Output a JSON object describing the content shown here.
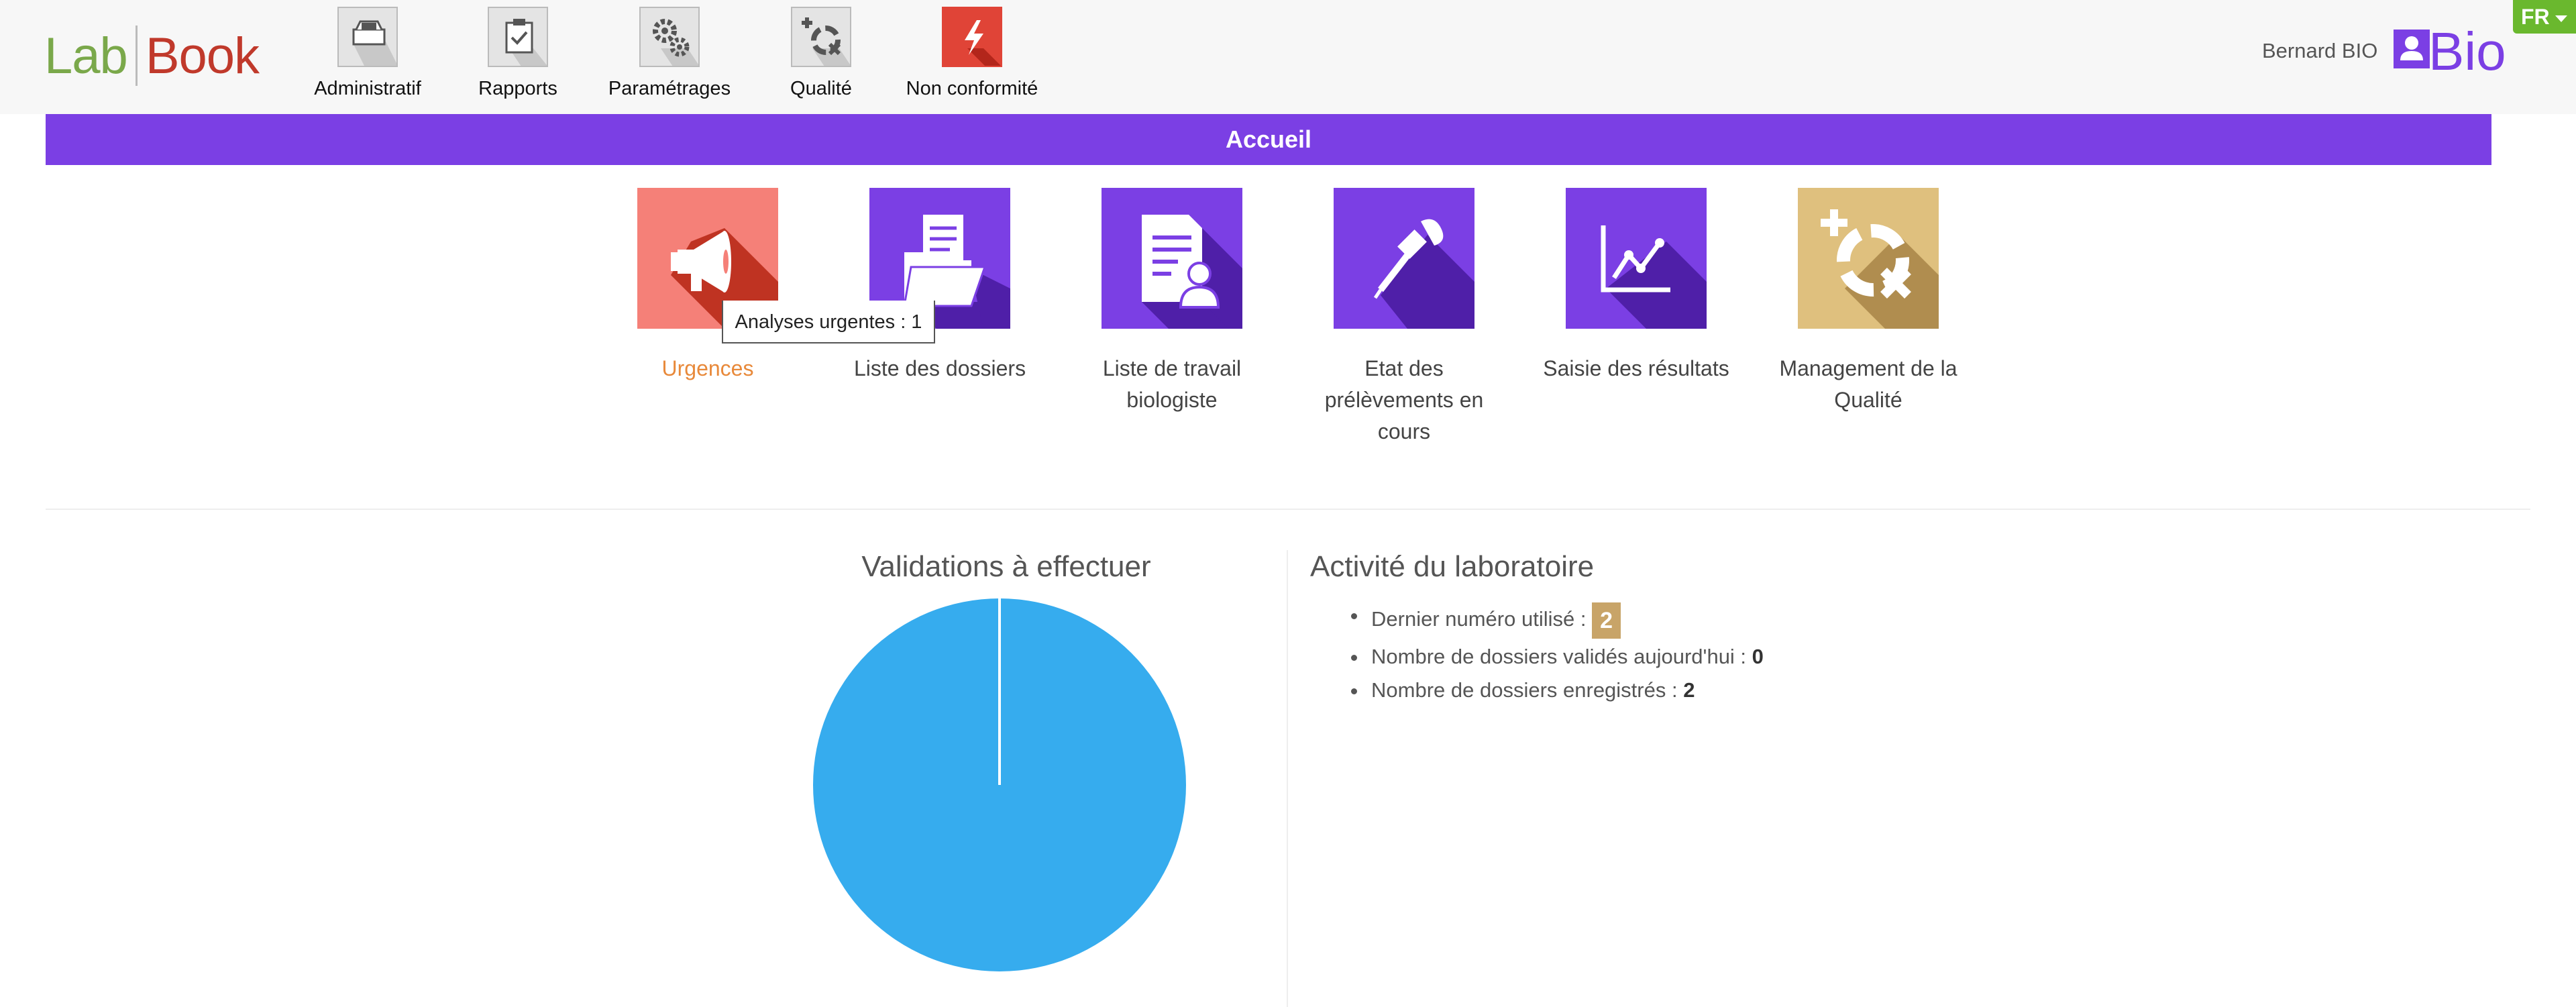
{
  "logo": {
    "part1": "Lab",
    "part2": "Book"
  },
  "menu": [
    {
      "label": "Administratif",
      "icon": "inbox-icon"
    },
    {
      "label": "Rapports",
      "icon": "clipboard-check-icon"
    },
    {
      "label": "Paramétrages",
      "icon": "gears-icon"
    },
    {
      "label": "Qualité",
      "icon": "quality-cycle-icon"
    },
    {
      "label": "Non conformité",
      "icon": "lightning-icon"
    }
  ],
  "user": {
    "name": "Bernard BIO",
    "role": "Bio",
    "icon": "user-icon"
  },
  "lang": {
    "label": "FR"
  },
  "banner": {
    "title": "Accueil"
  },
  "tiles": [
    {
      "label": "Urgences",
      "icon": "megaphone-icon",
      "color": "#f58078"
    },
    {
      "label": "Liste des dossiers",
      "icon": "folder-document-icon",
      "color": "#7b3fe4"
    },
    {
      "label": "Liste de travail biologiste",
      "icon": "document-user-icon",
      "color": "#7b3fe4"
    },
    {
      "label": "Etat des prélèvements en cours",
      "icon": "pipette-icon",
      "color": "#7b3fe4"
    },
    {
      "label": "Saisie des résultats",
      "icon": "line-chart-icon",
      "color": "#7b3fe4"
    },
    {
      "label": "Management de la Qualité",
      "icon": "quality-cycle-icon",
      "color": "#dfc07e"
    }
  ],
  "tooltip": {
    "text": "Analyses urgentes : 1"
  },
  "validations": {
    "title": "Validations à effectuer",
    "chart_data": {
      "type": "pie",
      "slices": [
        {
          "value": 100,
          "color": "#36acee"
        }
      ]
    }
  },
  "activity": {
    "title": "Activité du laboratoire",
    "items": [
      {
        "label": "Dernier numéro utilisé : ",
        "value": "2"
      },
      {
        "label": "Nombre de dossiers validés aujourd'hui : ",
        "value": "0"
      },
      {
        "label": "Nombre de dossiers enregistrés : ",
        "value": "2"
      }
    ]
  },
  "colors": {
    "accent": "#7b3fe4",
    "green": "#6ab82e",
    "badge": "#c8a468",
    "urgent_text": "#e8893a"
  }
}
